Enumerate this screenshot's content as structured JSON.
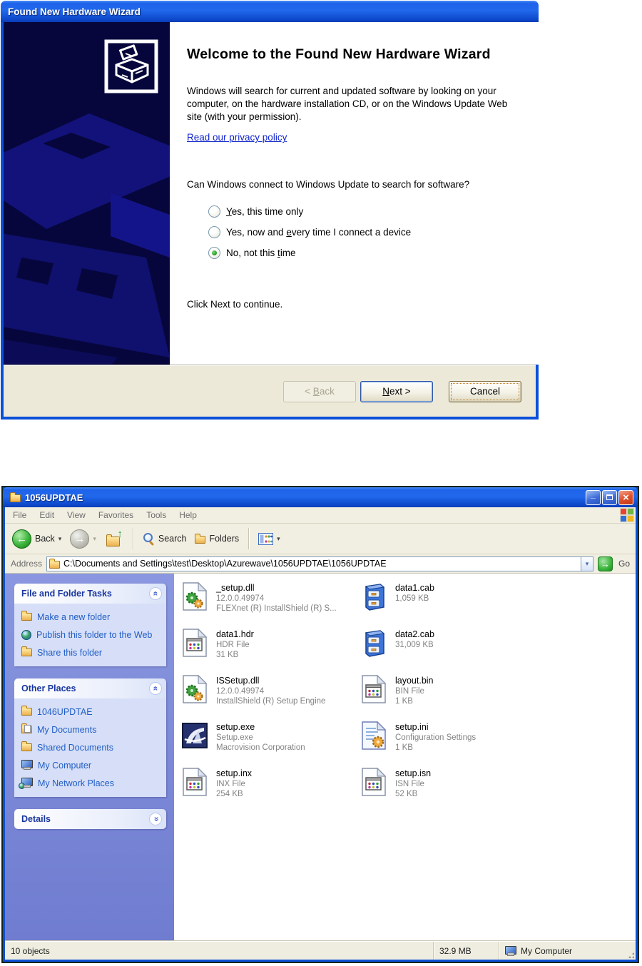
{
  "wizard": {
    "title": "Found New Hardware Wizard",
    "heading": "Welcome to the Found New Hardware Wizard",
    "body": "Windows will search for current and updated software by looking on your computer, on the hardware installation CD, or on the Windows Update Web site (with your permission).",
    "privacy_link": "Read our privacy policy",
    "question": "Can Windows connect to Windows Update to search for software?",
    "options": [
      {
        "pre": "",
        "u": "Y",
        "post": "es, this time only",
        "selected": false
      },
      {
        "pre": "Yes, now and ",
        "u": "e",
        "post": "very time I connect a device",
        "selected": false
      },
      {
        "pre": "No, not this ",
        "u": "t",
        "post": "ime",
        "selected": true
      }
    ],
    "footer_hint": "Click Next to continue.",
    "buttons": {
      "back": {
        "pre": "< ",
        "u": "B",
        "post": "ack"
      },
      "next": {
        "u": "N",
        "post": "ext >"
      },
      "cancel": {
        "label": "Cancel"
      }
    }
  },
  "explorer": {
    "title": "1056UPDTAE",
    "menu": [
      "File",
      "Edit",
      "View",
      "Favorites",
      "Tools",
      "Help"
    ],
    "toolbar": {
      "back": "Back",
      "search": "Search",
      "folders": "Folders"
    },
    "address_label": "Address",
    "address_path": "C:\\Documents and Settings\\test\\Desktop\\Azurewave\\1056UPDTAE\\1056UPDTAE",
    "go_label": "Go",
    "tasks_panel": {
      "title": "File and Folder Tasks",
      "items": [
        "Make a new folder",
        "Publish this folder to the Web",
        "Share this folder"
      ]
    },
    "places_panel": {
      "title": "Other Places",
      "items": [
        "1046UPDTAE",
        "My Documents",
        "Shared Documents",
        "My Computer",
        "My Network Places"
      ]
    },
    "details_panel": {
      "title": "Details"
    },
    "files": [
      {
        "name": "_setup.dll",
        "line1": "12.0.0.49974",
        "line2": "FLEXnet (R) InstallShield (R) S..."
      },
      {
        "name": "data1.cab",
        "line1": "1,059 KB",
        "line2": ""
      },
      {
        "name": "data1.hdr",
        "line1": "HDR File",
        "line2": "31 KB"
      },
      {
        "name": "data2.cab",
        "line1": "31,009 KB",
        "line2": ""
      },
      {
        "name": "ISSetup.dll",
        "line1": "12.0.0.49974",
        "line2": "InstallShield (R) Setup Engine"
      },
      {
        "name": "layout.bin",
        "line1": "BIN File",
        "line2": "1 KB"
      },
      {
        "name": "setup.exe",
        "line1": "Setup.exe",
        "line2": "Macrovision Corporation"
      },
      {
        "name": "setup.ini",
        "line1": "Configuration Settings",
        "line2": "1 KB"
      },
      {
        "name": "setup.inx",
        "line1": "INX File",
        "line2": "254 KB"
      },
      {
        "name": "setup.isn",
        "line1": "ISN File",
        "line2": "52 KB"
      }
    ],
    "status": {
      "objects": "10 objects",
      "size": "32.9 MB",
      "zone": "My Computer"
    }
  },
  "colors": {
    "titlebar_blue": "#1E63E9",
    "window_frame": "#0C50D8",
    "wizard_art_bg": "#06063C",
    "taskpane_bg": "#7585D6",
    "panel_body": "#D6DFF7",
    "link_blue": "#215DC6",
    "radio_selected_green": "#1D9A1D",
    "footer_gray": "#ECE9D8"
  }
}
